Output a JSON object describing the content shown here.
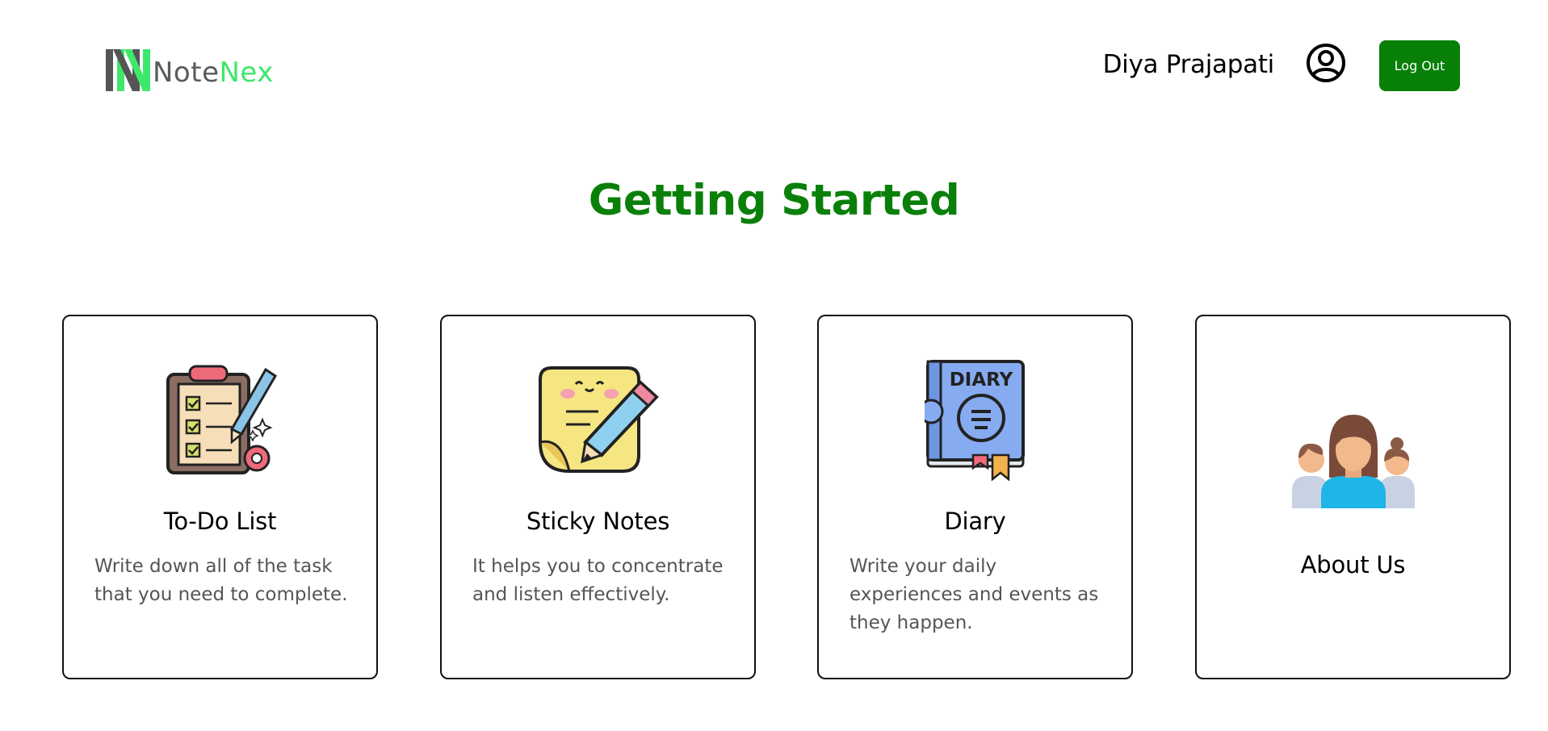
{
  "header": {
    "logo": {
      "text_part1": "Note",
      "text_part2": "Nex"
    },
    "username": "Diya Prajapati",
    "logout_label": "Log Out"
  },
  "main": {
    "title": "Getting Started",
    "cards": [
      {
        "title": "To-Do List",
        "description": "Write down all of the task that you need to complete.",
        "icon": "clipboard-checklist-icon"
      },
      {
        "title": "Sticky Notes",
        "description": "It helps you to concentrate and listen effectively.",
        "icon": "sticky-note-pencil-icon"
      },
      {
        "title": "Diary",
        "description": "Write your daily experiences and events as they happen.",
        "icon": "diary-book-icon"
      },
      {
        "title": "About Us",
        "description": "",
        "icon": "people-group-icon"
      }
    ]
  },
  "colors": {
    "brand_green": "#088008",
    "title_green": "#0a800a",
    "logo_gray": "#5a5a5a",
    "logo_bright_green": "#3ee86b"
  }
}
